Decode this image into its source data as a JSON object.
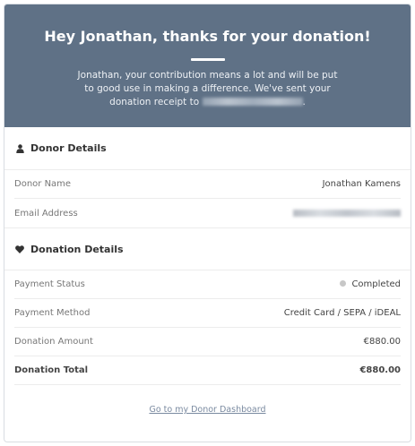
{
  "header": {
    "title": "Hey Jonathan, thanks for your donation!",
    "message_before": "Jonathan, your contribution means a lot and will be put to good use in making a difference. We've sent your donation receipt to",
    "message_after": "."
  },
  "donor_details": {
    "title": "Donor Details",
    "icon": "user-icon",
    "rows": [
      {
        "label": "Donor Name",
        "value": "Jonathan Kamens"
      },
      {
        "label": "Email Address",
        "value": ""
      }
    ]
  },
  "donation_details": {
    "title": "Donation Details",
    "icon": "heart-icon",
    "rows": [
      {
        "label": "Payment Status",
        "value": "Completed"
      },
      {
        "label": "Payment Method",
        "value": "Credit Card / SEPA / iDEAL"
      },
      {
        "label": "Donation Amount",
        "value": "€880.00"
      },
      {
        "label": "Donation Total",
        "value": "€880.00"
      }
    ]
  },
  "footer": {
    "link_label": "Go to my Donor Dashboard"
  },
  "colors": {
    "header_bg": "#5f7186",
    "status_dot": "#c7c7c7",
    "link": "#7a8aa0"
  }
}
